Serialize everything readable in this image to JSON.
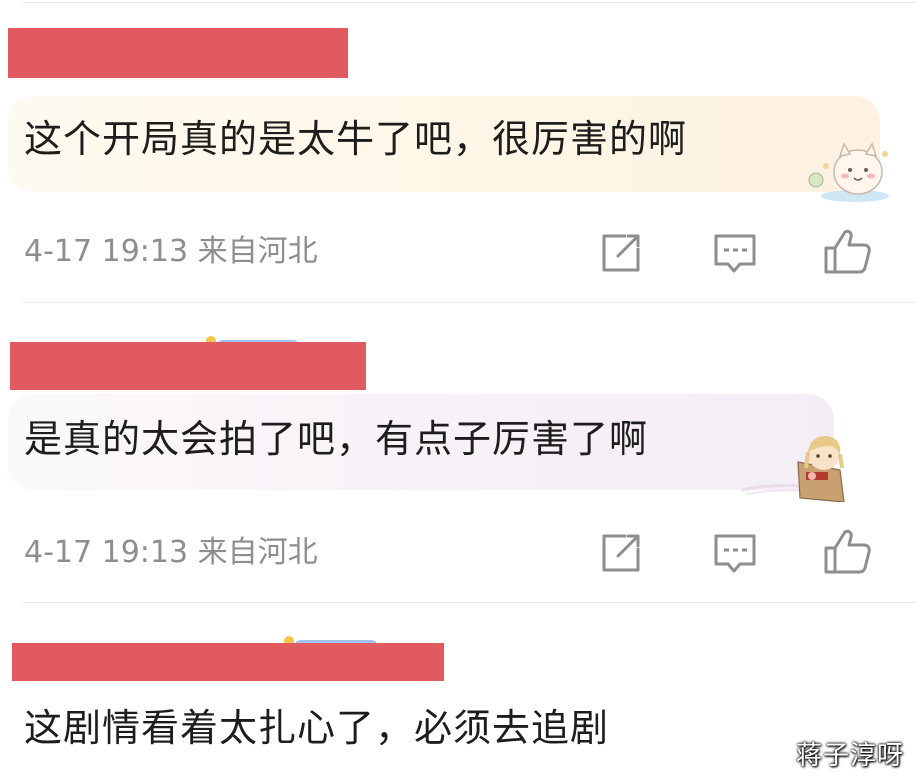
{
  "comments": [
    {
      "text": "这个开局真的是太牛了吧，很厉害的啊",
      "meta": "4-17 19:13 来自河北",
      "actions": [
        "share-icon",
        "comment-icon",
        "like-icon"
      ]
    },
    {
      "text": "是真的太会拍了吧，有点子厉害了啊",
      "meta": "4-17 19:13 来自河北",
      "actions": [
        "share-icon",
        "comment-icon",
        "like-icon"
      ]
    },
    {
      "text": "这剧情看着太扎心了，必须去追剧"
    }
  ],
  "colors": {
    "redaction": "#e05a60",
    "meta_text": "#8e8e8e",
    "body_text": "#1d1d1d"
  },
  "watermark": "蒋子淳呀"
}
